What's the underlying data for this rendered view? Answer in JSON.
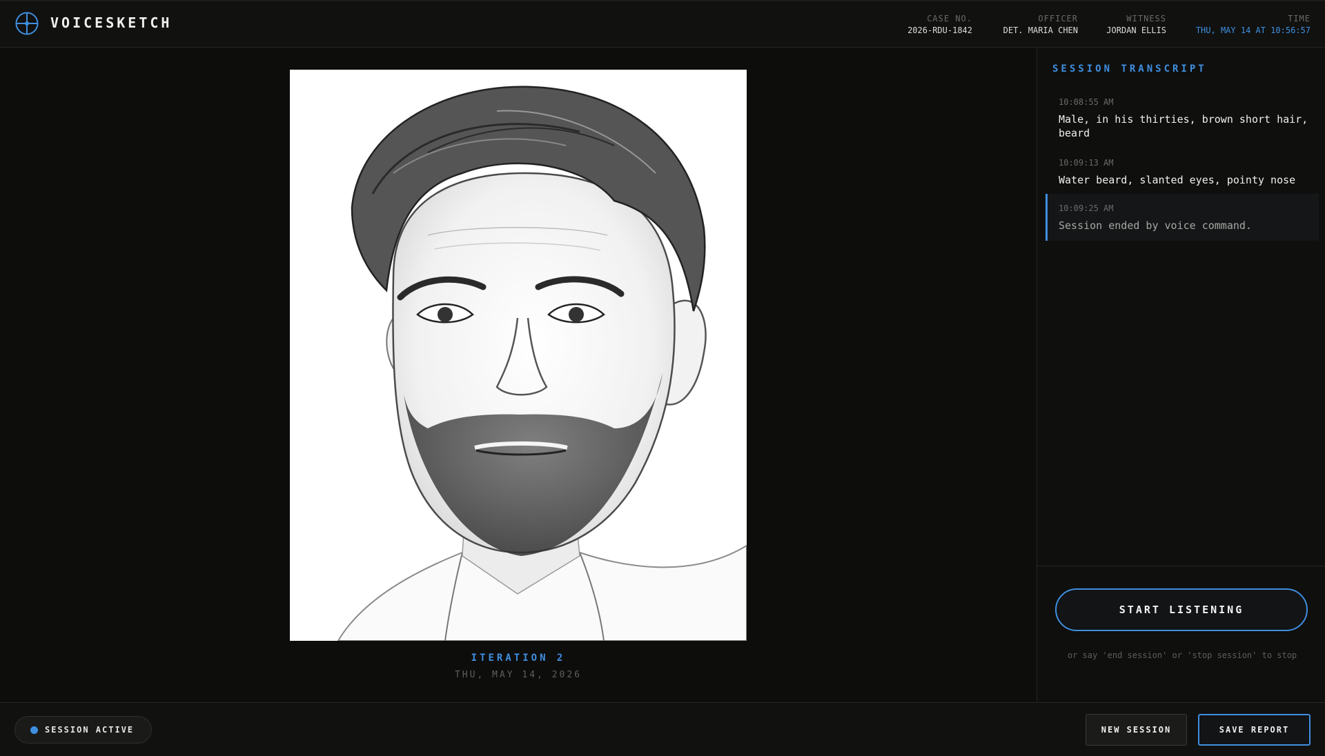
{
  "app": {
    "title": "VOICESKETCH",
    "logo_icon": "crosshair-icon",
    "accent_color": "#3f8fdf"
  },
  "header": {
    "case": {
      "label": "CASE NO.",
      "value": "2026-RDU-1842"
    },
    "officer": {
      "label": "OFFICER",
      "value": "DET. MARIA CHEN"
    },
    "witness": {
      "label": "WITNESS",
      "value": "JORDAN ELLIS"
    },
    "time": {
      "label": "TIME",
      "value": "THU, MAY 14 AT 10:56:57"
    }
  },
  "sketch": {
    "iteration_label": "ITERATION 2",
    "date": "THU, MAY 14, 2026"
  },
  "transcript": {
    "title": "SESSION TRANSCRIPT",
    "entries": [
      {
        "time": "10:08:55 AM",
        "text": "Male, in his thirties, brown short hair, beard"
      },
      {
        "time": "10:09:13 AM",
        "text": "Water beard, slanted eyes, pointy nose"
      },
      {
        "time": "10:09:25 AM",
        "text": "Session ended by voice command."
      }
    ]
  },
  "controls": {
    "listen_label": "START LISTENING",
    "listen_hint": "or say 'end session' or 'stop session' to stop"
  },
  "footer": {
    "status_label": "SESSION ACTIVE",
    "new_session_label": "NEW SESSION",
    "save_report_label": "SAVE REPORT"
  }
}
